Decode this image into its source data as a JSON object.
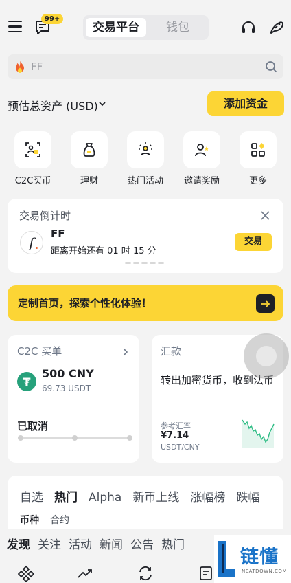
{
  "header": {
    "notification_badge": "99+",
    "tabs": [
      {
        "label": "交易平台",
        "active": true
      },
      {
        "label": "钱包",
        "active": false
      }
    ],
    "icons": [
      "menu-icon",
      "message-icon",
      "headset-icon",
      "bird-icon"
    ]
  },
  "search": {
    "placeholder": "FF",
    "icon_left": "fire-icon",
    "icon_right": "search-icon"
  },
  "assets": {
    "label": "预估总资产 (USD)",
    "add_funds": "添加资金"
  },
  "shortcuts": [
    {
      "label": "C2C买币",
      "icon": "c2c-icon"
    },
    {
      "label": "理财",
      "icon": "wealth-bag-icon"
    },
    {
      "label": "热门活动",
      "icon": "activity-icon"
    },
    {
      "label": "邀请奖励",
      "icon": "invite-icon"
    },
    {
      "label": "更多",
      "icon": "more-grid-icon"
    }
  ],
  "countdown": {
    "title": "交易倒计时",
    "symbol": "FF",
    "time_text": "距离开始还有 01 时 15 分",
    "trade_button": "交易",
    "logo_letter": "f"
  },
  "banner": {
    "text": "定制首页，探索个性化体验！"
  },
  "c2c_order": {
    "title": "C2C 买单",
    "amount": "500 CNY",
    "usdt": "69.73 USDT",
    "status": "已取消",
    "coin_symbol": "₮"
  },
  "remittance": {
    "title": "汇款",
    "description": "转出加密货币，收到法币",
    "rate_label": "参考汇率",
    "rate_value": "¥7.14",
    "pair": "USDT/CNY"
  },
  "markets": {
    "tabs": [
      {
        "label": "自选",
        "active": false
      },
      {
        "label": "热门",
        "active": true
      },
      {
        "label": "Alpha",
        "active": false
      },
      {
        "label": "新币上线",
        "active": false
      },
      {
        "label": "涨幅榜",
        "active": false
      },
      {
        "label": "跌幅",
        "active": false
      }
    ],
    "sub_tabs": [
      {
        "label": "币种",
        "active": true
      },
      {
        "label": "合约",
        "active": false
      }
    ]
  },
  "feed": {
    "tabs": [
      {
        "label": "发现",
        "active": true
      },
      {
        "label": "关注",
        "active": false
      },
      {
        "label": "活动",
        "active": false
      },
      {
        "label": "新闻",
        "active": false
      },
      {
        "label": "公告",
        "active": false
      },
      {
        "label": "热门",
        "active": false
      }
    ]
  },
  "bottom_nav": [
    "home-icon",
    "markets-icon",
    "trade-icon",
    "assets-icon"
  ],
  "watermark": {
    "title": "链懂",
    "url": "NEATDOWN.COM"
  },
  "colors": {
    "accent": "#fcd535",
    "text": "#1e2026",
    "muted": "#707a8a",
    "background": "#f3f3f3",
    "tether": "#26a17b",
    "watermark": "#1a73c8"
  }
}
